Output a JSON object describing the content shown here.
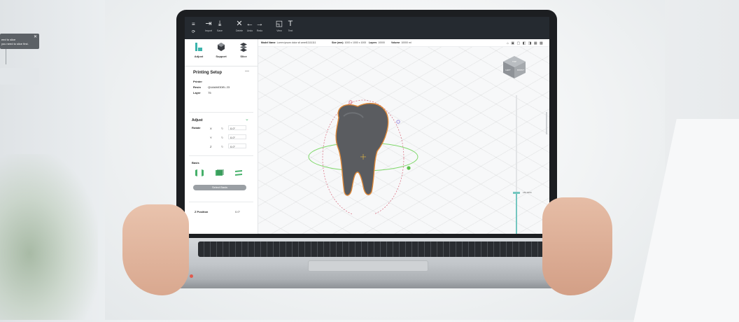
{
  "toast": {
    "line1": "eed to slice",
    "line2": "you need to slice first.",
    "close": "✕"
  },
  "toolbar": {
    "buttons": [
      {
        "label": "Import",
        "icon": "import-icon"
      },
      {
        "label": "Save",
        "icon": "save-icon"
      },
      {
        "label": "Delete",
        "icon": "delete-icon"
      },
      {
        "label": "Undo",
        "icon": "undo-icon"
      },
      {
        "label": "Redo",
        "icon": "redo-icon"
      },
      {
        "label": "View",
        "icon": "view-icon"
      },
      {
        "label": "Text",
        "icon": "text-icon"
      }
    ]
  },
  "sidebar": {
    "tools": [
      {
        "label": "Adjust",
        "icon": "adjust-icon"
      },
      {
        "label": "Support",
        "icon": "support-icon"
      },
      {
        "label": "Slice",
        "icon": "slice-icon"
      }
    ],
    "printing_setup": {
      "title": "Printing Setup",
      "collapse": "—",
      "printer_label": "Printer",
      "resin_label": "Resin",
      "resin_value": "QUAAMODEL 23",
      "layer_label": "Layer",
      "layer_value": "75"
    },
    "adjust": {
      "title": "Adjust",
      "rotate_label": "Rotate",
      "axes": [
        {
          "name": "X",
          "value": "0.0°"
        },
        {
          "name": "Y",
          "value": "0.0°"
        },
        {
          "name": "Z",
          "value": "0.0°"
        }
      ]
    },
    "basis": {
      "label": "Basis",
      "select_button": "Select Basis"
    },
    "z_position": {
      "label": "Z Position",
      "value": "0.0°"
    }
  },
  "viewport": {
    "model_name_label": "Model Name",
    "model_name_value": "Lorem ipsum dolor sit amet11111111",
    "size_label": "Size (mm)",
    "size_value": "1000 x 1000 x 1000",
    "layers_label": "Layers",
    "layers_value": "10000",
    "volume_label": "Volume",
    "volume_value": "10000 ml",
    "cube_top": "TOP",
    "cube_left": "LEFT",
    "cube_right": "FRONT",
    "z_slider_value": "180.0000"
  },
  "colors": {
    "toolbar_bg": "#252a30",
    "accent_green": "#46b06a",
    "tooth_outline": "#e08a3a",
    "slider_teal": "#74c6c0"
  }
}
